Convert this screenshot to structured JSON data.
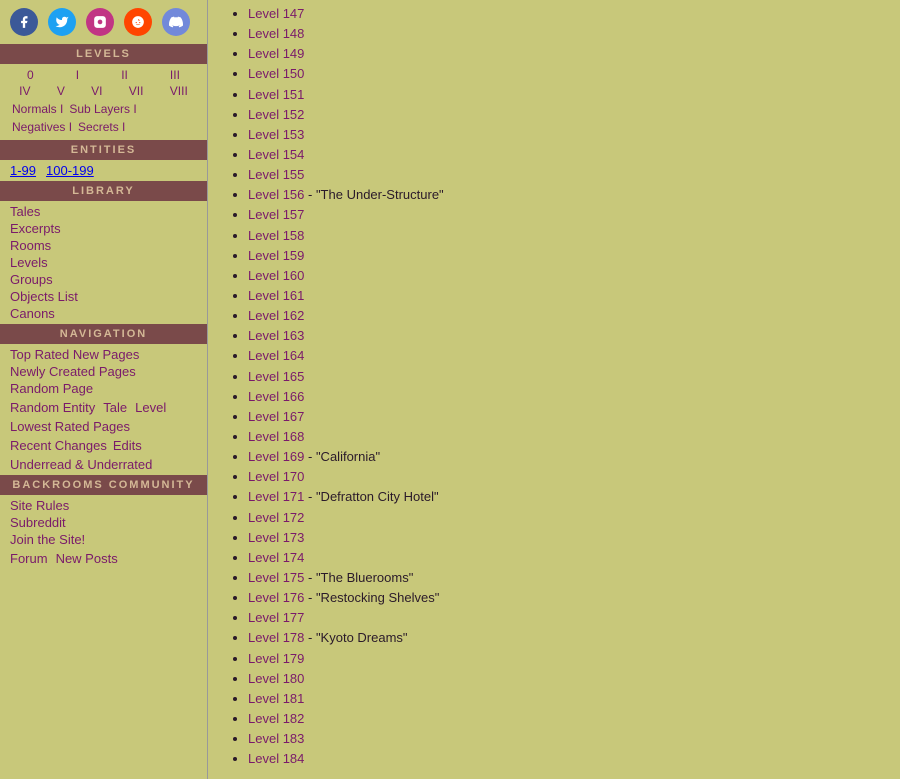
{
  "sidebar": {
    "social_icons": [
      {
        "name": "facebook",
        "symbol": "f"
      },
      {
        "name": "twitter",
        "symbol": "𝕏"
      },
      {
        "name": "instagram",
        "symbol": "◎"
      },
      {
        "name": "reddit",
        "symbol": "ʀ"
      },
      {
        "name": "discord",
        "symbol": "⌥"
      }
    ],
    "levels_header": "LEVELS",
    "levels_row1": [
      "0",
      "I",
      "II",
      "III"
    ],
    "levels_row2": [
      "IV",
      "V",
      "VI",
      "VII",
      "VIII"
    ],
    "levels_row3": [
      "Normals I",
      "Sub Layers I"
    ],
    "levels_row4": [
      "Negatives I",
      "Secrets I"
    ],
    "entities_header": "ENTITIES",
    "entities_links": [
      "1-99",
      "100-199"
    ],
    "library_header": "LIBRARY",
    "library_links": [
      "Tales",
      "Excerpts",
      "Rooms",
      "Levels",
      "Groups",
      "Objects List",
      "Canons"
    ],
    "navigation_header": "NAVIGATION",
    "nav_links1": [
      "Top Rated New Pages"
    ],
    "nav_links2": [
      "Newly Created Pages"
    ],
    "nav_links3": [
      "Random Page"
    ],
    "nav_inline": [
      "Random Entity",
      "Tale",
      "Level"
    ],
    "nav_links4": [
      "Lowest Rated Pages"
    ],
    "recent_changes": "Recent Changes",
    "edits": "Edits",
    "underread": "Underread & Underrated",
    "community_header": "BACKROOMS COMMUNITY",
    "community_links": [
      "Site Rules",
      "Subreddit",
      "Join the Site!"
    ],
    "community_bottom": [
      "Forum",
      "New Posts"
    ]
  },
  "main": {
    "levels": [
      {
        "num": "147",
        "name": ""
      },
      {
        "num": "148",
        "name": ""
      },
      {
        "num": "149",
        "name": ""
      },
      {
        "num": "150",
        "name": ""
      },
      {
        "num": "151",
        "name": ""
      },
      {
        "num": "152",
        "name": ""
      },
      {
        "num": "153",
        "name": ""
      },
      {
        "num": "154",
        "name": ""
      },
      {
        "num": "155",
        "name": ""
      },
      {
        "num": "156",
        "name": "\"The Under-Structure\""
      },
      {
        "num": "157",
        "name": ""
      },
      {
        "num": "158",
        "name": ""
      },
      {
        "num": "159",
        "name": ""
      },
      {
        "num": "160",
        "name": ""
      },
      {
        "num": "161",
        "name": ""
      },
      {
        "num": "162",
        "name": ""
      },
      {
        "num": "163",
        "name": ""
      },
      {
        "num": "164",
        "name": ""
      },
      {
        "num": "165",
        "name": ""
      },
      {
        "num": "166",
        "name": ""
      },
      {
        "num": "167",
        "name": ""
      },
      {
        "num": "168",
        "name": ""
      },
      {
        "num": "169",
        "name": "\"California\""
      },
      {
        "num": "170",
        "name": ""
      },
      {
        "num": "171",
        "name": "\"Defratton City Hotel\""
      },
      {
        "num": "172",
        "name": ""
      },
      {
        "num": "173",
        "name": ""
      },
      {
        "num": "174",
        "name": ""
      },
      {
        "num": "175",
        "name": "\"The Bluerooms\""
      },
      {
        "num": "176",
        "name": "\"Restocking Shelves\""
      },
      {
        "num": "177",
        "name": ""
      },
      {
        "num": "178",
        "name": "\"Kyoto Dreams\""
      },
      {
        "num": "179",
        "name": ""
      },
      {
        "num": "180",
        "name": ""
      },
      {
        "num": "181",
        "name": ""
      },
      {
        "num": "182",
        "name": ""
      },
      {
        "num": "183",
        "name": ""
      },
      {
        "num": "184",
        "name": ""
      }
    ]
  }
}
